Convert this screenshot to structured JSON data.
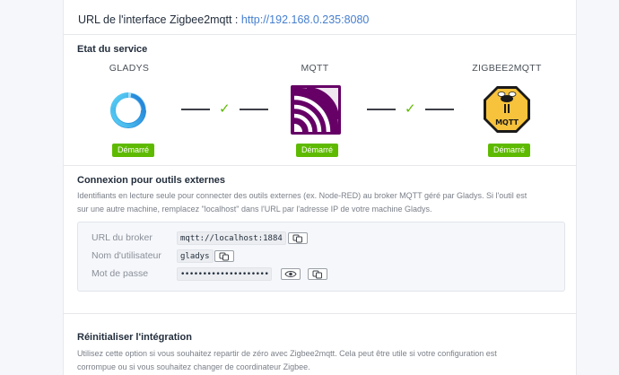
{
  "url": {
    "label": "URL de l'interface Zigbee2mqtt :",
    "link": "http://192.168.0.235:8080"
  },
  "service": {
    "title": "Etat du service",
    "items": [
      {
        "name": "GLADYS",
        "status": "Démarré",
        "icon": "gladys-logo-icon"
      },
      {
        "name": "MQTT",
        "status": "Démarré",
        "icon": "mqtt-logo-icon"
      },
      {
        "name": "ZIGBEE2MQTT",
        "status": "Démarré",
        "icon": "zigbee2mqtt-logo-icon"
      }
    ],
    "connector_icon": "check-icon",
    "status_color": "#5eba00"
  },
  "external": {
    "title": "Connexion pour outils externes",
    "description": "Identifiants en lecture seule pour connecter des outils externes (ex. Node-RED) au broker MQTT géré par Gladys. Si l'outil est sur une autre machine, remplacez \"localhost\" dans l'URL par l'adresse IP de votre machine Gladys.",
    "description_line1": "Identifiants en lecture seule pour connecter des outils externes (ex. Node-RED) au broker MQTT géré par Gladys. Si l'outil est",
    "description_line2": "sur une autre machine, remplacez \"localhost\" dans l'URL par l'adresse IP de votre machine Gladys.",
    "broker_label": "URL du broker",
    "broker_value": "mqtt://localhost:1884",
    "user_label": "Nom d'utilisateur",
    "user_value": "gladys",
    "password_label": "Mot de passe",
    "password_value": "••••••••••••••••••••",
    "copy_icon": "copy-icon",
    "eye_icon": "eye-icon"
  },
  "reset": {
    "title": "Réinitialiser l'intégration",
    "description_line1": "Utilisez cette option si vous souhaitez repartir de zéro avec Zigbee2mqtt. Cela peut être utile si votre configuration est",
    "description_line2": "corrompue ou si vous souhaitez changer de coordinateur Zigbee."
  }
}
